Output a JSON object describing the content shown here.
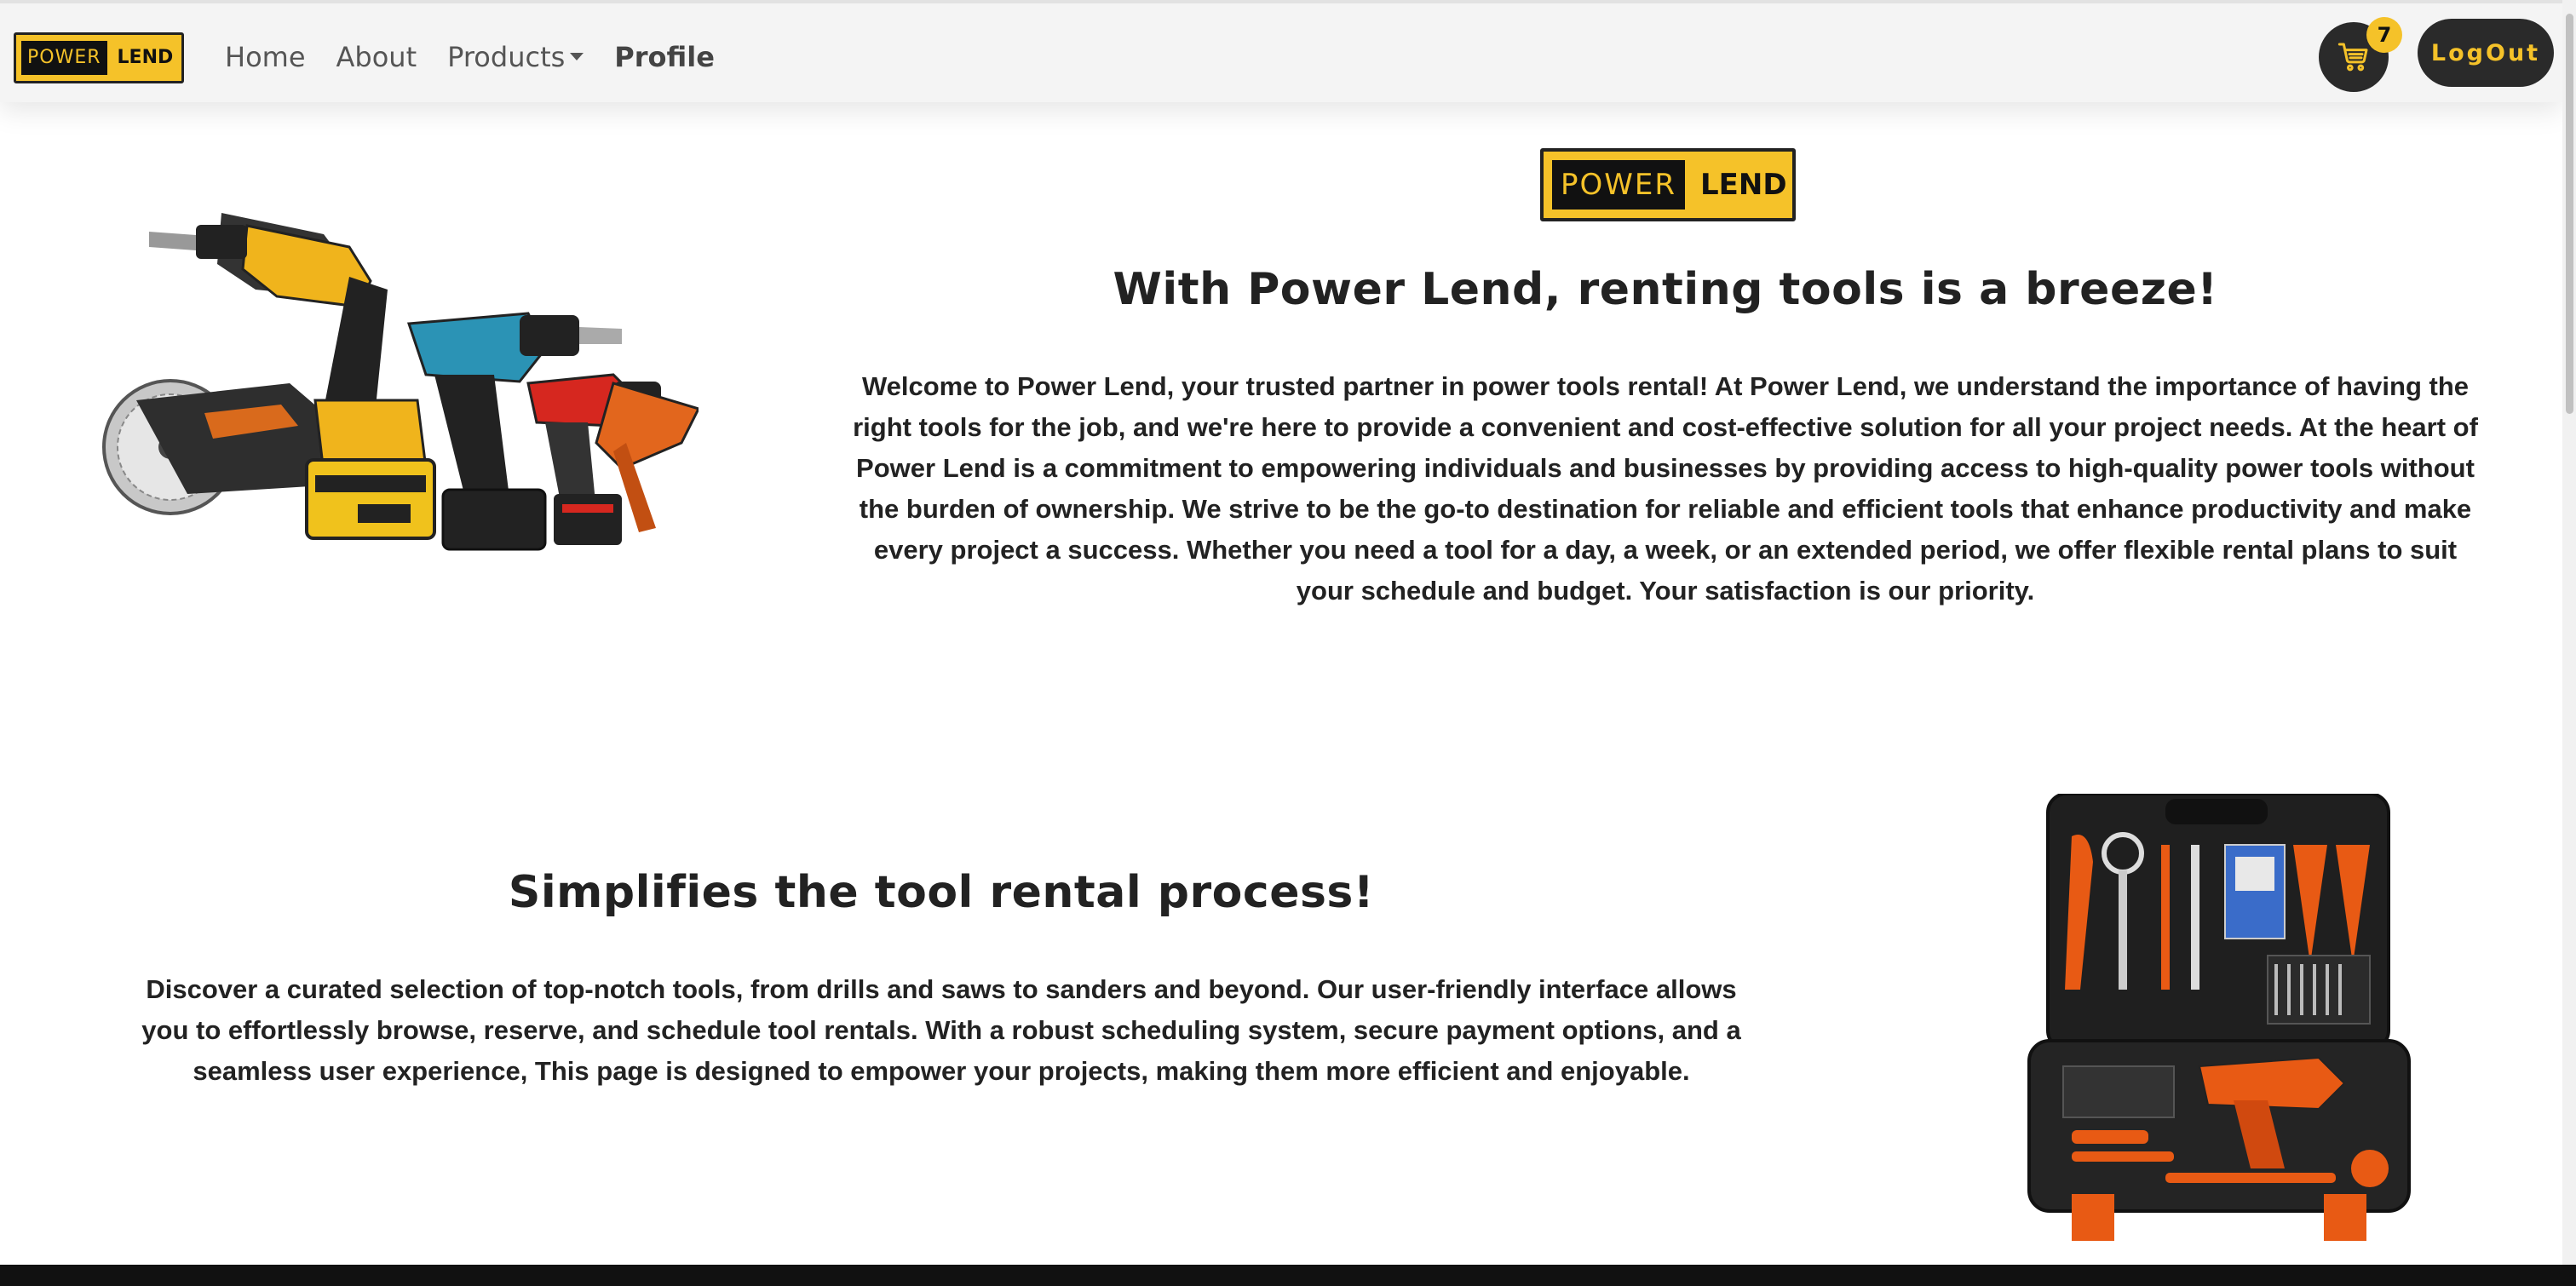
{
  "brand": {
    "word1": "POWER",
    "word2": "LEND"
  },
  "nav": {
    "home": "Home",
    "about": "About",
    "products": "Products",
    "profile": "Profile"
  },
  "cart": {
    "count": "7"
  },
  "logout_label": "LogOut",
  "hero": {
    "logo_word1": "POWER",
    "logo_word2": "LEND",
    "heading": "With Power Lend, renting tools is a breeze!",
    "body": "Welcome to Power Lend, your trusted partner in power tools rental! At Power Lend, we understand the importance of having the right tools for the job, and we're here to provide a convenient and cost-effective solution for all your project needs. At the heart of Power Lend is a commitment to empowering individuals and businesses by providing access to high-quality power tools without the burden of ownership. We strive to be the go-to destination for reliable and efficient tools that enhance productivity and make every project a success. Whether you need a tool for a day, a week, or an extended period, we offer flexible rental plans to suit your schedule and budget. Your satisfaction is our priority."
  },
  "features": {
    "heading": "Simplifies the tool rental process!",
    "body": "Discover a curated selection of top-notch tools, from drills and saws to sanders and beyond. Our user-friendly interface allows you to effortlessly browse, reserve, and schedule tool rentals. With a robust scheduling system, secure payment options, and a seamless user experience, This page is designed to empower your projects, making them more efficient and enjoyable."
  },
  "images": {
    "hero_image": "power-tools-collection",
    "toolkit_image": "orange-tool-kit-case"
  },
  "colors": {
    "brand_yellow": "#f5c229",
    "dark": "#2a2a2a",
    "navbar_bg": "#f4f4f4",
    "text": "#222222"
  }
}
